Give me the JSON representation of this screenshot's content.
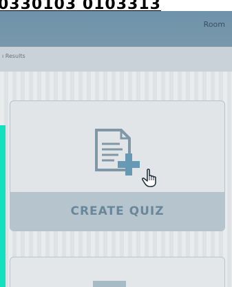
{
  "top_band": {
    "text": "0330103 0103313"
  },
  "header": {
    "room_label": "Room"
  },
  "subbar": {
    "text": "ı Results"
  },
  "quiz_card": {
    "label": "CREATE QUIZ",
    "icon": "document-plus-icon"
  },
  "cursor": {
    "icon": "hand-pointer-icon"
  },
  "colors": {
    "header": "#7898ab",
    "accent_plus": "#6699b3",
    "card_label_bg": "#b5c4cd",
    "card_label_text": "#6a8799",
    "side_strip": "#12e0be"
  }
}
